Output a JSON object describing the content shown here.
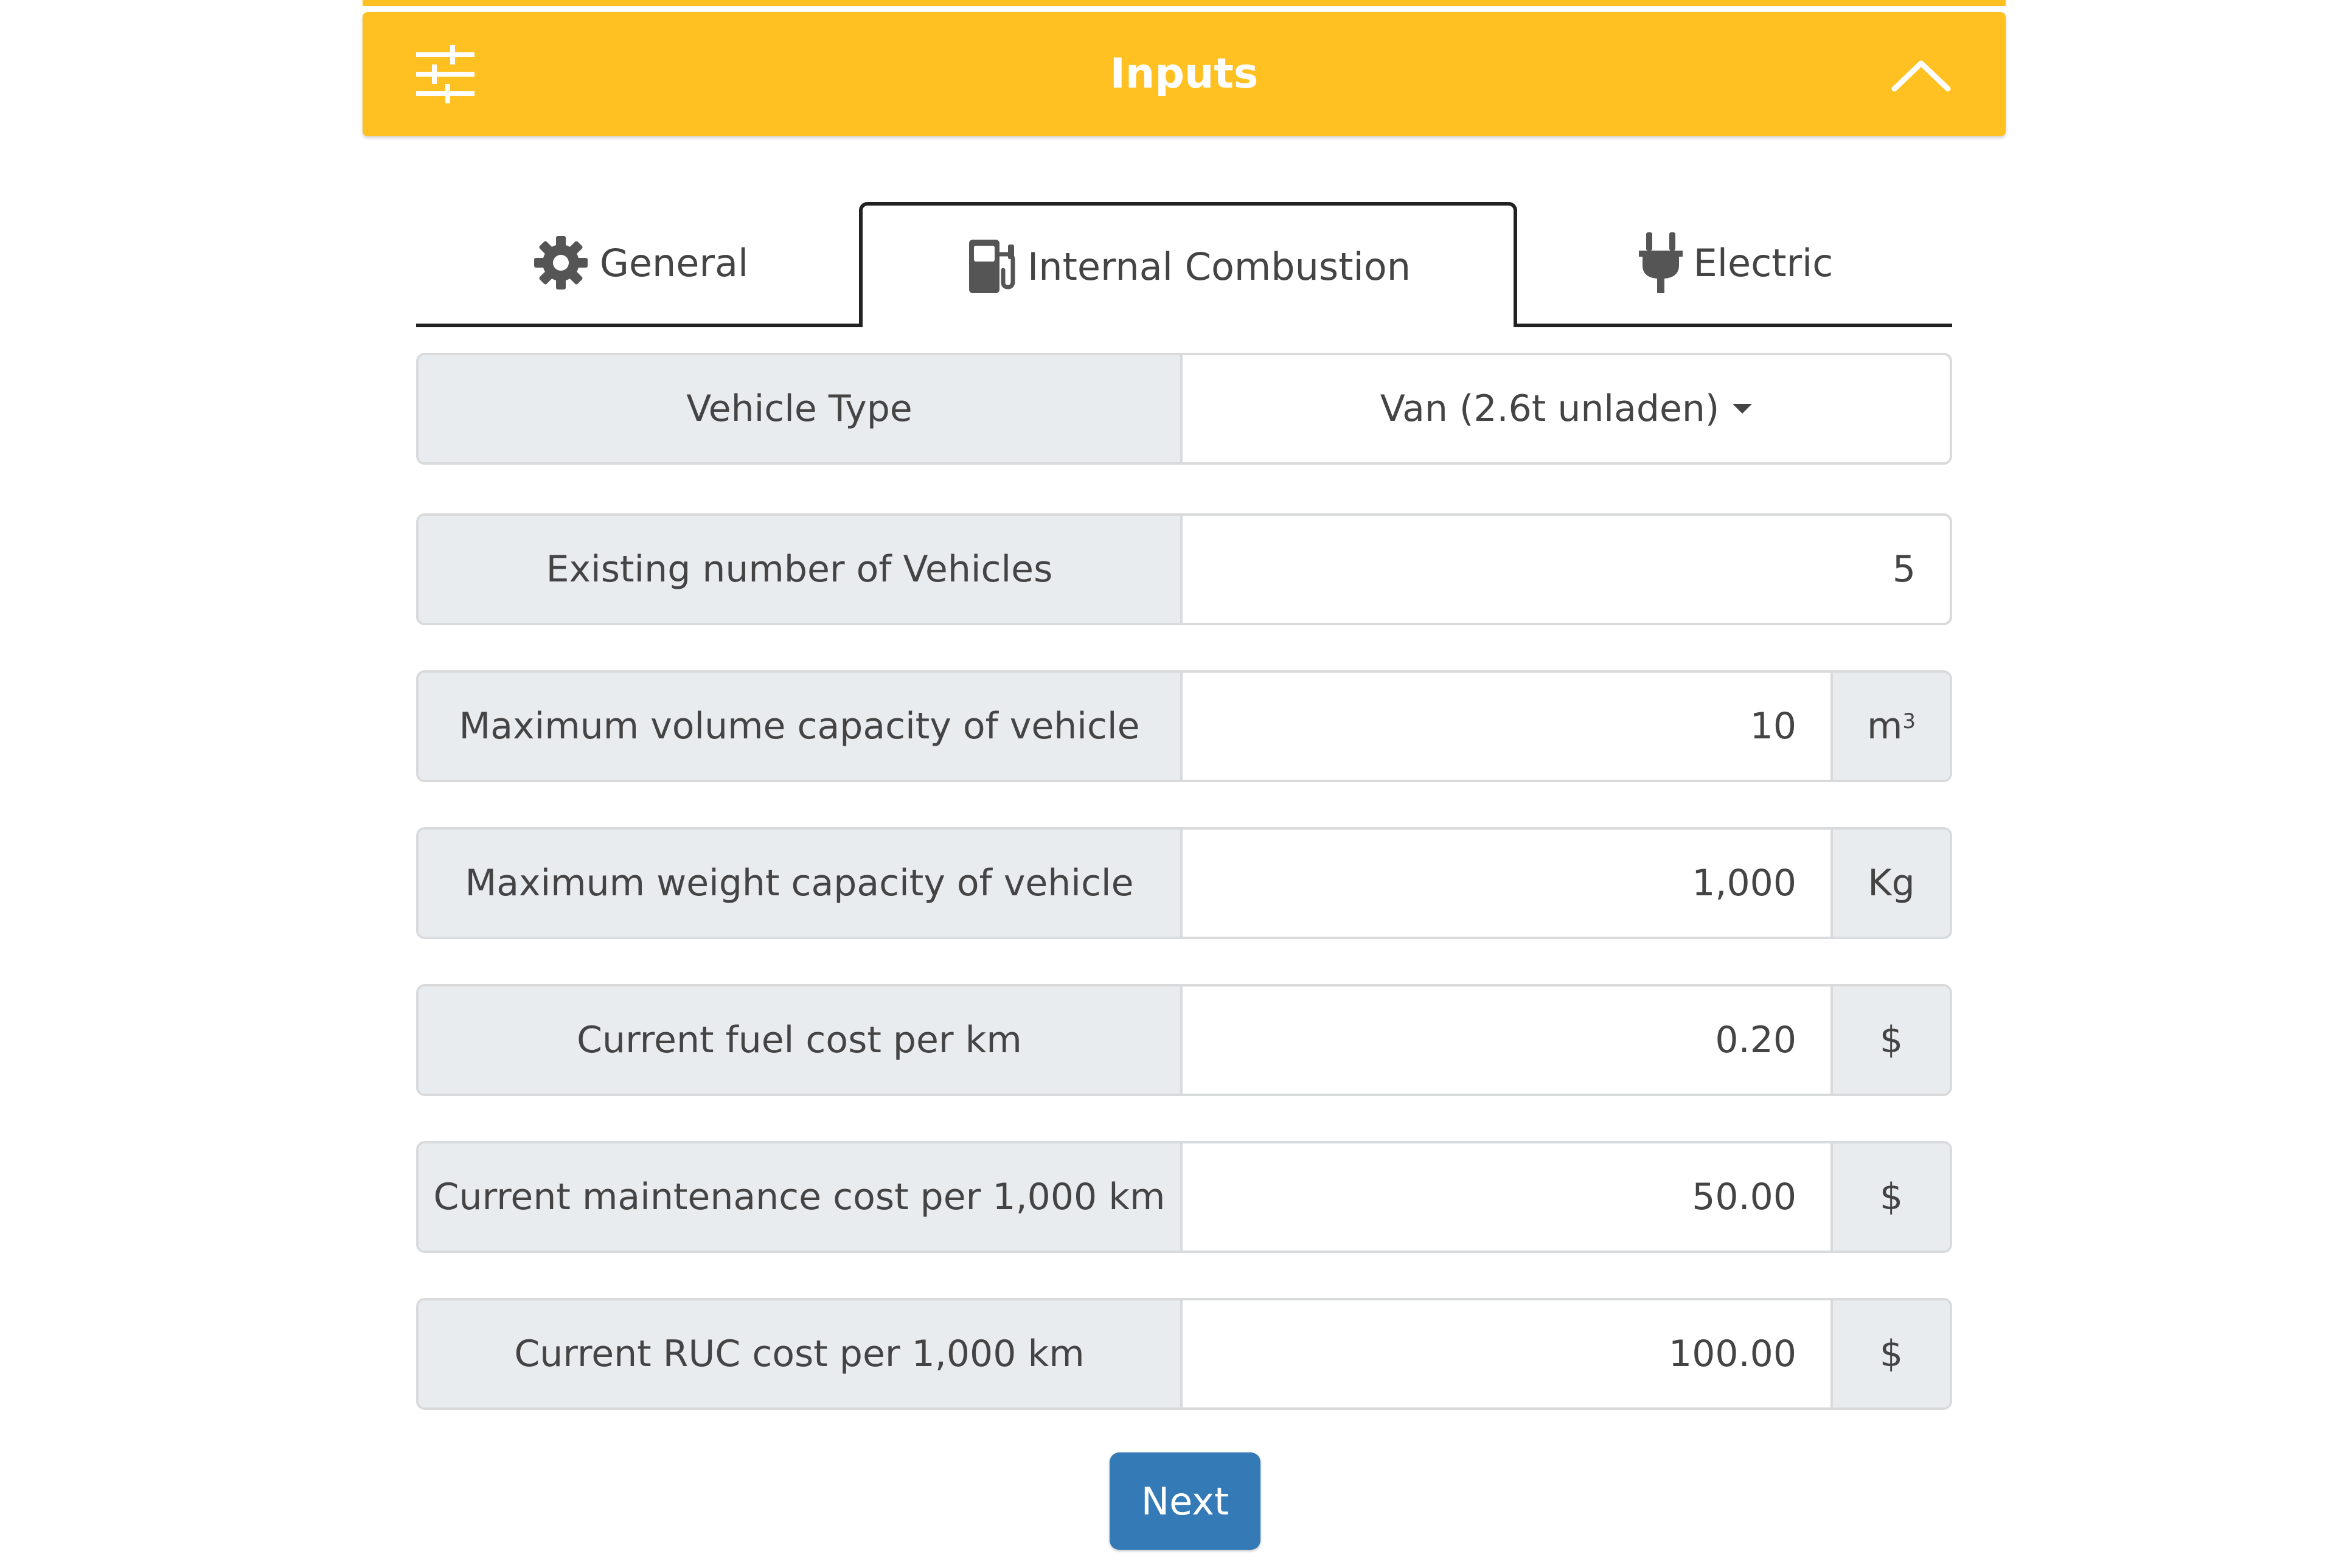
{
  "header": {
    "title": "Inputs",
    "accent_color": "#ffc122",
    "left_icon": "sliders-icon",
    "right_icon": "chevron-up-icon"
  },
  "tabs": [
    {
      "label": "General",
      "icon": "gear-icon",
      "active": false
    },
    {
      "label": "Internal Combustion",
      "icon": "fuel-pump-icon",
      "active": true
    },
    {
      "label": "Electric",
      "icon": "plug-icon",
      "active": false
    }
  ],
  "fields": [
    {
      "label": "Vehicle Type",
      "value": "Van (2.6t unladen)",
      "unit": "",
      "type": "dropdown"
    },
    {
      "label": "Existing number of Vehicles",
      "value": "5",
      "unit": "",
      "type": "number"
    },
    {
      "label": "Maximum volume capacity of vehicle",
      "value": "10",
      "unit": "m",
      "unit_sup": "3",
      "type": "number"
    },
    {
      "label": "Maximum weight capacity of vehicle",
      "value": "1,000",
      "unit": "Kg",
      "type": "number"
    },
    {
      "label": "Current fuel cost per km",
      "value": "0.20",
      "unit": "$",
      "type": "number"
    },
    {
      "label": "Current maintenance cost per 1,000 km",
      "value": "50.00",
      "unit": "$",
      "type": "number"
    },
    {
      "label": "Current RUC cost per 1,000 km",
      "value": "100.00",
      "unit": "$",
      "type": "number"
    }
  ],
  "actions": {
    "next_label": "Next",
    "next_color": "#337ab7"
  }
}
